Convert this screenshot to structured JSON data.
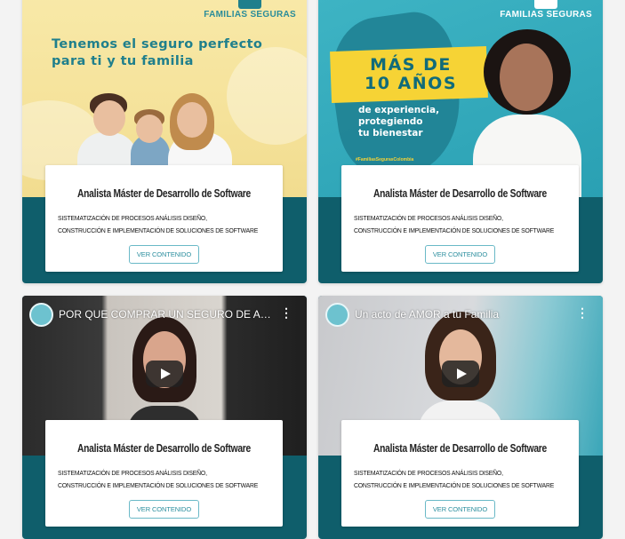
{
  "cards": [
    {
      "banner": {
        "logo_text": "FAMILIAS SEGURAS",
        "headline_line1": "Tenemos el seguro perfecto",
        "headline_line2": "para ti y tu familia"
      },
      "title": "Analista Máster de Desarrollo de Software",
      "desc_line1": "SISTEMATIZACIÓN DE PROCESOS ANÁLISIS DISEÑO,",
      "desc_line2": "CONSTRUCCIÓN E IMPLEMENTACIÓN DE SOLUCIONES DE SOFTWARE",
      "button": "VER CONTENIDO"
    },
    {
      "banner": {
        "logo_text": "FAMILIAS SEGURAS",
        "big_line1": "MÁS DE",
        "big_line2": "10 AÑOS",
        "sub_line1": "de experiencia,",
        "sub_line2": "protegiendo",
        "sub_line3": "tu bienestar",
        "hashtag": "#FamiliasSegurasColombia"
      },
      "title": "Analista Máster de Desarrollo de Software",
      "desc_line1": "SISTEMATIZACIÓN DE PROCESOS ANÁLISIS DISEÑO,",
      "desc_line2": "CONSTRUCCIÓN E IMPLEMENTACIÓN DE SOLUCIONES DE SOFTWARE",
      "button": "VER CONTENIDO"
    },
    {
      "video": {
        "title": "POR QUE COMPRAR UN SEGURO DE AHOR...",
        "more": "⋮"
      },
      "title": "Analista Máster de Desarrollo de Software",
      "desc_line1": "SISTEMATIZACIÓN DE PROCESOS ANÁLISIS DISEÑO,",
      "desc_line2": "CONSTRUCCIÓN E IMPLEMENTACIÓN DE SOLUCIONES DE SOFTWARE",
      "button": "VER CONTENIDO"
    },
    {
      "video": {
        "title": "Un acto de AMOR a tu Familia",
        "more": "⋮"
      },
      "title": "Analista Máster de Desarrollo de Software",
      "desc_line1": "SISTEMATIZACIÓN DE PROCESOS ANÁLISIS DISEÑO,",
      "desc_line2": "CONSTRUCCIÓN E IMPLEMENTACIÓN DE SOLUCIONES DE SOFTWARE",
      "button": "VER CONTENIDO"
    }
  ],
  "colors": {
    "accent": "#0f5e6b",
    "button_border": "#6ab9c7",
    "button_text": "#2b8e9e"
  }
}
